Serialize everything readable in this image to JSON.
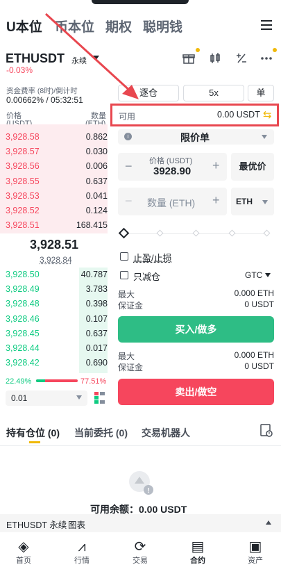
{
  "topnav": {
    "tabs": [
      "U本位",
      "币本位",
      "期权",
      "聪明钱"
    ]
  },
  "header": {
    "symbol": "ETHUSDT",
    "type": "永续",
    "change": "-0.03%"
  },
  "funding": {
    "label": "资金费率 (8时)/倒计时",
    "value": "0.00662% / 05:32:51"
  },
  "book": {
    "price_label": "价格",
    "price_unit": "(USDT)",
    "qty_label": "数量",
    "qty_unit": "(ETH)",
    "asks": [
      {
        "p": "3,928.58",
        "q": "0.862"
      },
      {
        "p": "3,928.57",
        "q": "0.030"
      },
      {
        "p": "3,928.56",
        "q": "0.006"
      },
      {
        "p": "3,928.55",
        "q": "0.637"
      },
      {
        "p": "3,928.53",
        "q": "0.041"
      },
      {
        "p": "3,928.52",
        "q": "0.124"
      },
      {
        "p": "3,928.51",
        "q": "168.415"
      }
    ],
    "last_price": "3,928.51",
    "mark_price": "3,928.84",
    "bids": [
      {
        "p": "3,928.50",
        "q": "40.787"
      },
      {
        "p": "3,928.49",
        "q": "3.783"
      },
      {
        "p": "3,928.48",
        "q": "0.398"
      },
      {
        "p": "3,928.46",
        "q": "0.107"
      },
      {
        "p": "3,928.45",
        "q": "0.637"
      },
      {
        "p": "3,928.44",
        "q": "0.017"
      },
      {
        "p": "3,928.42",
        "q": "0.690"
      }
    ],
    "buy_pct": "22.49%",
    "sell_pct": "77.51%",
    "buy_fraction": 0.2249,
    "precision": "0.01"
  },
  "order": {
    "margin_mode": "逐仓",
    "leverage": "5x",
    "mode": "单",
    "available_label": "可用",
    "available_value": "0.00 USDT",
    "order_type": "限价单",
    "price_label": "价格 (USDT)",
    "price_value": "3928.90",
    "best_price": "最优价",
    "qty_placeholder": "数量 (ETH)",
    "qty_unit": "ETH",
    "tp_sl": "止盈/止损",
    "reduce_only": "只减仓",
    "tif": "GTC",
    "max_label": "最大",
    "max_buy": "0.000 ETH",
    "margin_label": "保证金",
    "margin_buy": "0 USDT",
    "buy_button": "买入/做多",
    "max_sell": "0.000 ETH",
    "margin_sell": "0 USDT",
    "sell_button": "卖出/做空"
  },
  "tabs": {
    "positions": "持有仓位",
    "positions_count": "(0)",
    "orders": "当前委托",
    "orders_count": "(0)",
    "bots": "交易机器人"
  },
  "empty": {
    "text": "可用余额：0.00 USDT"
  },
  "footer_bar": {
    "symbol": "ETHUSDT 永续",
    "chart": "图表"
  },
  "bottomnav": [
    "首页",
    "行情",
    "交易",
    "合约",
    "资产"
  ],
  "colors": {
    "green": "#0ecb81",
    "red": "#f6465d",
    "yellow": "#f0b90b",
    "annotation": "#e8474f"
  }
}
